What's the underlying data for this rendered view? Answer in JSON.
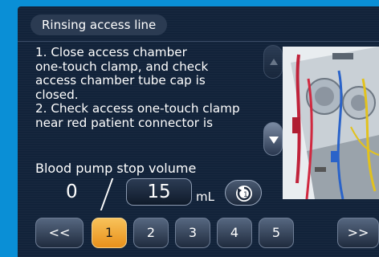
{
  "header": {
    "title": "Rinsing access line"
  },
  "instructions": {
    "text": "1. Close access chamber\none-touch clamp, and check\naccess chamber tube cap is\nclosed.\n2. Check access one-touch clamp\nnear red patient connector is"
  },
  "stop_volume": {
    "label": "Blood pump stop volume",
    "current": "0",
    "target": "15",
    "unit": "mL"
  },
  "pagination": {
    "prev_label": "<<",
    "next_label": ">>",
    "pages": [
      "1",
      "2",
      "3",
      "4",
      "5"
    ],
    "current_page": "1"
  },
  "colors": {
    "accent": "#f0a63a",
    "panel": "#12233a",
    "frame": "#0a8fd6"
  },
  "icons": {
    "reset": "reset-icon",
    "scroll_up": "triangle-up-icon",
    "scroll_down": "triangle-down-icon"
  }
}
